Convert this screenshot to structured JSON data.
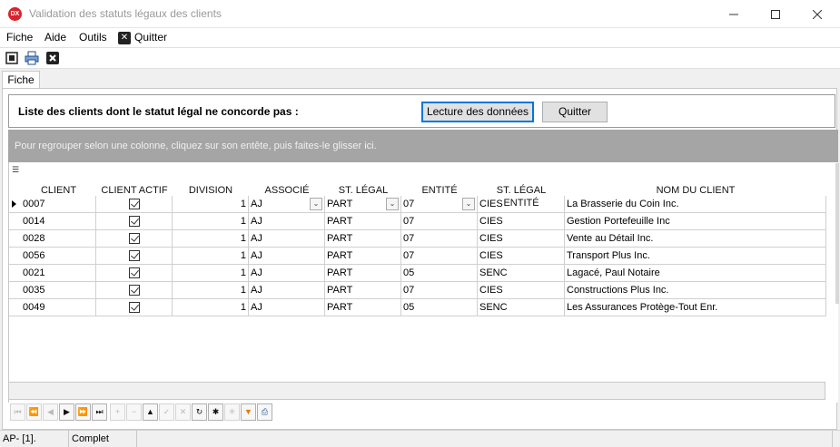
{
  "window": {
    "title": "Validation des statuts légaux des clients",
    "app_badge": "DX"
  },
  "menu": {
    "items": [
      "Fiche",
      "Aide",
      "Outils"
    ],
    "quit": "Quitter"
  },
  "tabs": [
    "Fiche"
  ],
  "header": {
    "label": "Liste des clients dont le statut légal ne concorde pas :",
    "read_button": "Lecture des données",
    "quit_button": "Quitter"
  },
  "grid": {
    "group_hint": "Pour regrouper selon une colonne, cliquez sur son entête, puis faites-le glisser ici.",
    "columns": [
      "CLIENT",
      "CLIENT ACTIF",
      "DIVISION",
      "ASSOCIÉ",
      "ST. LÉGAL",
      "ENTITÉ",
      "ST. LÉGAL ENTITÉ",
      "NOM DU CLIENT"
    ],
    "rows": [
      {
        "client": "0007",
        "actif": true,
        "division": "1",
        "associe": "AJ",
        "st_legal": "PART",
        "entite": "07",
        "st_legal_entite": "CIES",
        "nom": "La Brasserie du Coin Inc."
      },
      {
        "client": "0014",
        "actif": true,
        "division": "1",
        "associe": "AJ",
        "st_legal": "PART",
        "entite": "07",
        "st_legal_entite": "CIES",
        "nom": "Gestion Portefeuille Inc"
      },
      {
        "client": "0028",
        "actif": true,
        "division": "1",
        "associe": "AJ",
        "st_legal": "PART",
        "entite": "07",
        "st_legal_entite": "CIES",
        "nom": "Vente au Détail Inc."
      },
      {
        "client": "0056",
        "actif": true,
        "division": "1",
        "associe": "AJ",
        "st_legal": "PART",
        "entite": "07",
        "st_legal_entite": "CIES",
        "nom": "Transport Plus Inc."
      },
      {
        "client": "0021",
        "actif": true,
        "division": "1",
        "associe": "AJ",
        "st_legal": "PART",
        "entite": "05",
        "st_legal_entite": "SENC",
        "nom": "Lagacé, Paul Notaire"
      },
      {
        "client": "0035",
        "actif": true,
        "division": "1",
        "associe": "AJ",
        "st_legal": "PART",
        "entite": "07",
        "st_legal_entite": "CIES",
        "nom": "Constructions Plus  Inc."
      },
      {
        "client": "0049",
        "actif": true,
        "division": "1",
        "associe": "AJ",
        "st_legal": "PART",
        "entite": "05",
        "st_legal_entite": "SENC",
        "nom": "Les Assurances Protège-Tout Enr."
      }
    ]
  },
  "status": {
    "left": "AP- [1].",
    "state": "Complet"
  },
  "colors": {
    "accent": "#0078d7",
    "group_panel": "#a5a5a5",
    "app_badge": "#d9232e"
  }
}
